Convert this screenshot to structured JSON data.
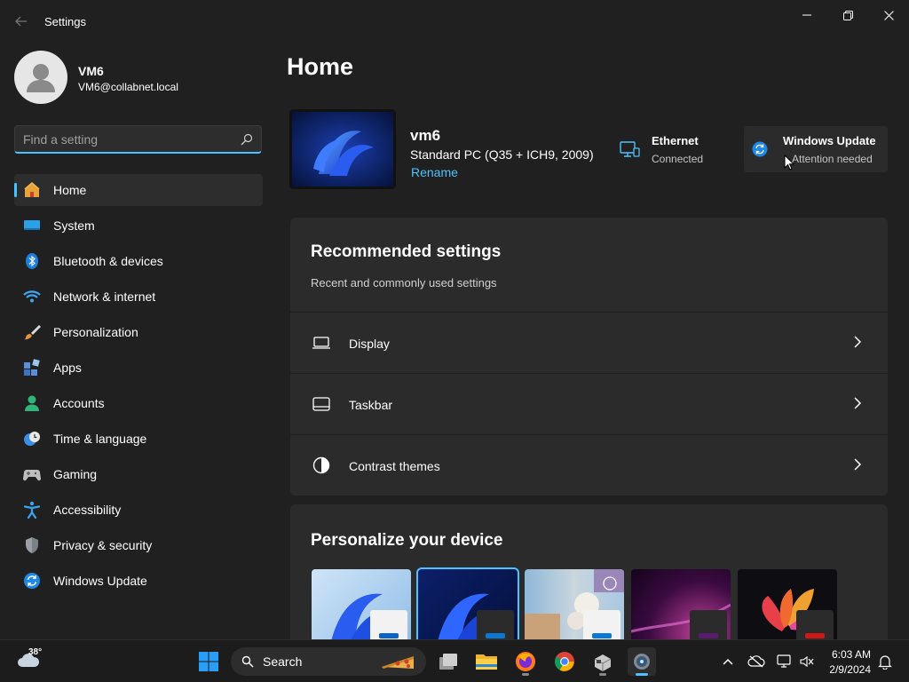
{
  "window": {
    "title": "Settings",
    "controls": {
      "minimize": "minimize",
      "maximize": "maximize",
      "close": "close"
    }
  },
  "profile": {
    "name": "VM6",
    "email": "VM6@collabnet.local"
  },
  "search": {
    "placeholder": "Find a setting",
    "value": ""
  },
  "sidebar": {
    "items": [
      {
        "label": "Home",
        "icon": "home-icon",
        "active": true
      },
      {
        "label": "System",
        "icon": "system-icon"
      },
      {
        "label": "Bluetooth & devices",
        "icon": "bluetooth-icon"
      },
      {
        "label": "Network & internet",
        "icon": "wifi-icon"
      },
      {
        "label": "Personalization",
        "icon": "brush-icon"
      },
      {
        "label": "Apps",
        "icon": "apps-icon"
      },
      {
        "label": "Accounts",
        "icon": "account-icon"
      },
      {
        "label": "Time & language",
        "icon": "clock-globe-icon"
      },
      {
        "label": "Gaming",
        "icon": "gamepad-icon"
      },
      {
        "label": "Accessibility",
        "icon": "accessibility-icon"
      },
      {
        "label": "Privacy & security",
        "icon": "shield-icon"
      },
      {
        "label": "Windows Update",
        "icon": "update-icon"
      }
    ]
  },
  "main": {
    "title": "Home",
    "device": {
      "name": "vm6",
      "model": "Standard PC (Q35 + ICH9, 2009)",
      "rename_label": "Rename"
    },
    "ethernet": {
      "title": "Ethernet",
      "status": "Connected"
    },
    "windows_update": {
      "title": "Windows Update",
      "status": "Attention needed"
    },
    "recommended": {
      "title": "Recommended settings",
      "subtitle": "Recent and commonly used settings",
      "rows": [
        {
          "label": "Display",
          "icon": "display-icon"
        },
        {
          "label": "Taskbar",
          "icon": "taskbar-icon"
        },
        {
          "label": "Contrast themes",
          "icon": "contrast-icon"
        }
      ]
    },
    "personalize": {
      "title": "Personalize your device",
      "themes": [
        {
          "name": "windows-light-theme",
          "selected": false,
          "accent": "#0a64c8"
        },
        {
          "name": "windows-dark-theme",
          "selected": true,
          "accent": "#0a78d4"
        },
        {
          "name": "spotlight-theme",
          "selected": false,
          "accent": "#0a78d4"
        },
        {
          "name": "glow-theme",
          "selected": false,
          "accent": "#5a1a6e"
        },
        {
          "name": "captured-motion-theme",
          "selected": false,
          "accent": "#d01818"
        }
      ]
    }
  },
  "taskbar": {
    "weather_temp": "38°",
    "search_label": "Search",
    "clock_time": "6:03 AM",
    "clock_date": "2/9/2024"
  },
  "colors": {
    "accent": "#4cc2ff",
    "background": "#202020",
    "card": "#2b2b2b"
  }
}
